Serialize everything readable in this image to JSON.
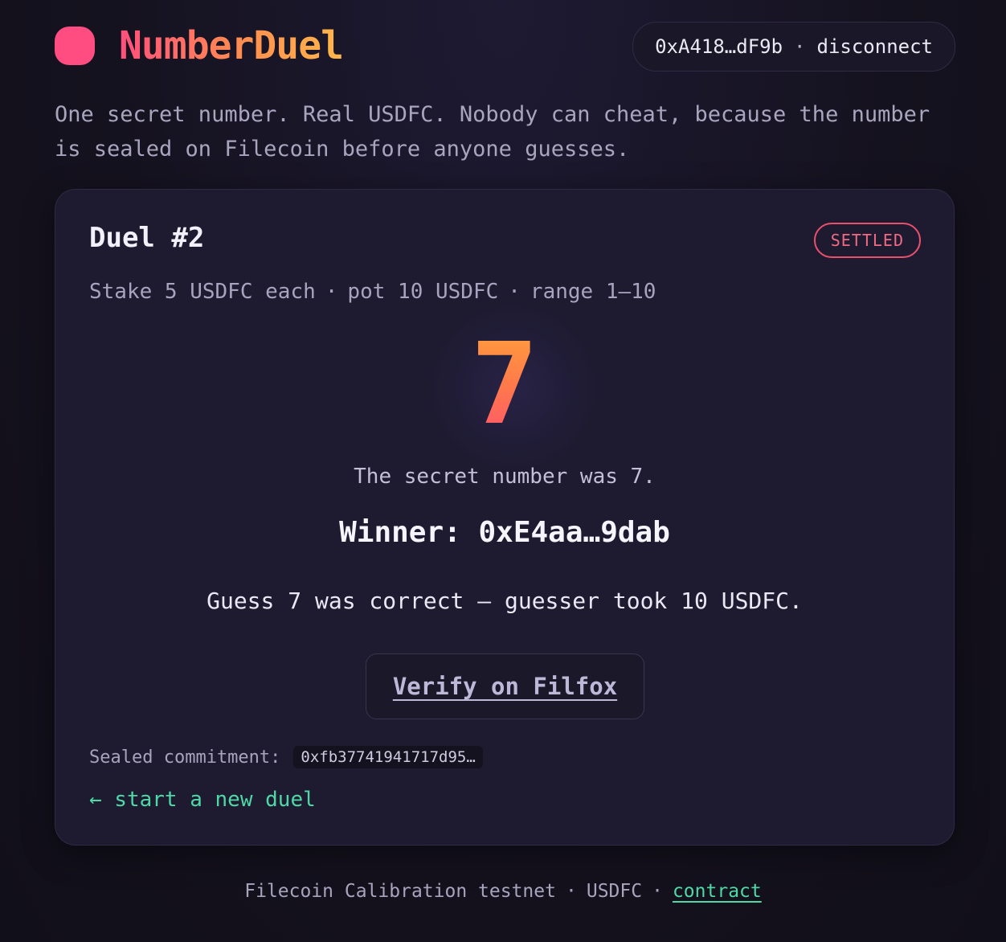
{
  "app": {
    "name": "NumberDuel",
    "logo_icon": "blob-logo-icon",
    "accent_color": "#ff4d82"
  },
  "wallet": {
    "address": "0xA418…dF9b",
    "separator": "·",
    "disconnect_label": "disconnect"
  },
  "tagline": "One secret number. Real USDFC. Nobody can cheat, because the number is sealed on Filecoin before anyone guesses.",
  "duel": {
    "title": "Duel #2",
    "status": "SETTLED",
    "status_color": "#e8506e",
    "meta": {
      "stake": "Stake 5 USDFC each",
      "pot": "pot 10 USDFC",
      "range": "range 1–10",
      "separator": "·"
    },
    "secret_number": "7",
    "reveal_text": "The secret number was 7.",
    "winner_text": "Winner: 0xE4aa…9dab",
    "result_text": "Guess 7 was correct — guesser took 10 USDFC.",
    "verify_label": "Verify on Filfox",
    "commitment_label": "Sealed commitment:",
    "commitment_hash": "0xfb37741941717d95…",
    "new_duel_label": "← start a new duel",
    "link_color": "#4fd8a6"
  },
  "footer": {
    "network": "Filecoin Calibration testnet",
    "token": "USDFC",
    "separator": "·",
    "contract_label": "contract"
  }
}
